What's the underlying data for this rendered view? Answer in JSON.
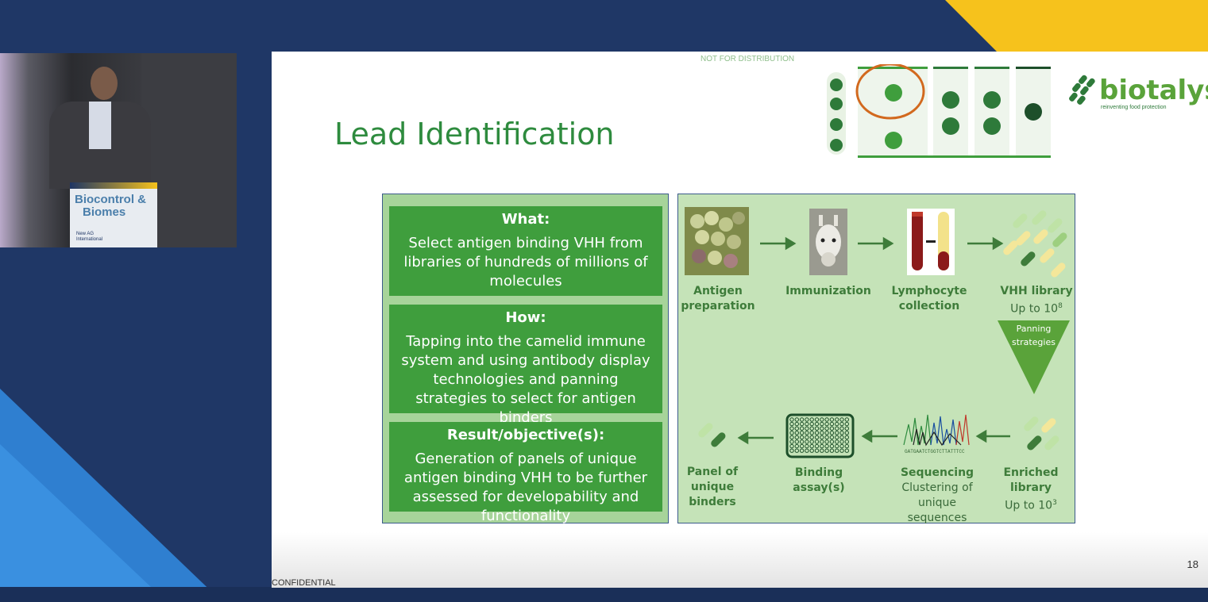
{
  "slide": {
    "distribution_note": "NOT FOR DISTRIBUTION",
    "title": "Lead Identification",
    "confidential": "CONFIDENTIAL",
    "page_number": "18"
  },
  "logo": {
    "name": "biotalys",
    "tagline": "reinventing food protection"
  },
  "podium": {
    "title_line1": "Biocontrol &",
    "title_line2": "Biomes",
    "sub_line1": "New AG",
    "sub_line2": "International"
  },
  "left_boxes": [
    {
      "heading": "What:",
      "text": "Select antigen binding VHH from libraries of hundreds of millions of molecules"
    },
    {
      "heading": "How:",
      "text": "Tapping into the camelid immune system and using antibody display technologies and panning strategies to select for antigen binders"
    },
    {
      "heading": "Result/objective(s):",
      "text": "Generation of panels of unique antigen binding VHH to be further assessed for developability and functionality"
    }
  ],
  "flow": {
    "antigen_1": "Antigen",
    "antigen_2": "preparation",
    "immunization": "Immunization",
    "lymphocyte_1": "Lymphocyte",
    "lymphocyte_2": "collection",
    "vhh_1": "VHH library",
    "vhh_2": "Up to 10",
    "vhh_exp": "8",
    "panning_1": "Panning",
    "panning_2": "strategies",
    "enriched_1": "Enriched library",
    "enriched_2": "Up to 10",
    "enriched_exp": "3",
    "seq_1": "Sequencing",
    "seq_2": "Clustering of",
    "seq_3": "unique",
    "seq_4": "sequences",
    "binding": "Binding assay(s)",
    "panel_1": "Panel of",
    "panel_2": "unique",
    "panel_3": "binders"
  },
  "colors": {
    "accent_green": "#3f9e3d",
    "title_green": "#2e8b3e",
    "navy": "#1e3564",
    "gold": "#f6c21c"
  }
}
